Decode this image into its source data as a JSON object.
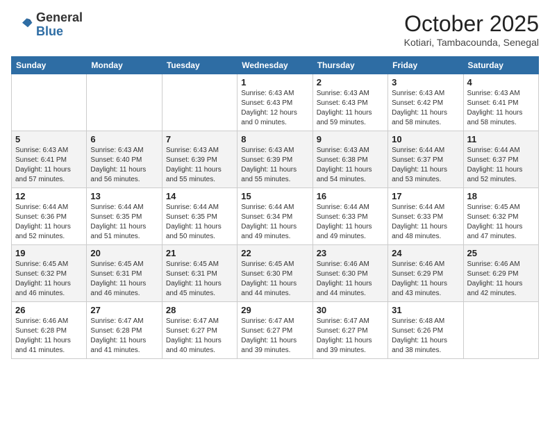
{
  "header": {
    "logo_line1": "General",
    "logo_line2": "Blue",
    "month_title": "October 2025",
    "subtitle": "Kotiari, Tambacounda, Senegal"
  },
  "weekdays": [
    "Sunday",
    "Monday",
    "Tuesday",
    "Wednesday",
    "Thursday",
    "Friday",
    "Saturday"
  ],
  "weeks": [
    [
      {
        "day": "",
        "info": ""
      },
      {
        "day": "",
        "info": ""
      },
      {
        "day": "",
        "info": ""
      },
      {
        "day": "1",
        "info": "Sunrise: 6:43 AM\nSunset: 6:43 PM\nDaylight: 12 hours\nand 0 minutes."
      },
      {
        "day": "2",
        "info": "Sunrise: 6:43 AM\nSunset: 6:43 PM\nDaylight: 11 hours\nand 59 minutes."
      },
      {
        "day": "3",
        "info": "Sunrise: 6:43 AM\nSunset: 6:42 PM\nDaylight: 11 hours\nand 58 minutes."
      },
      {
        "day": "4",
        "info": "Sunrise: 6:43 AM\nSunset: 6:41 PM\nDaylight: 11 hours\nand 58 minutes."
      }
    ],
    [
      {
        "day": "5",
        "info": "Sunrise: 6:43 AM\nSunset: 6:41 PM\nDaylight: 11 hours\nand 57 minutes."
      },
      {
        "day": "6",
        "info": "Sunrise: 6:43 AM\nSunset: 6:40 PM\nDaylight: 11 hours\nand 56 minutes."
      },
      {
        "day": "7",
        "info": "Sunrise: 6:43 AM\nSunset: 6:39 PM\nDaylight: 11 hours\nand 55 minutes."
      },
      {
        "day": "8",
        "info": "Sunrise: 6:43 AM\nSunset: 6:39 PM\nDaylight: 11 hours\nand 55 minutes."
      },
      {
        "day": "9",
        "info": "Sunrise: 6:43 AM\nSunset: 6:38 PM\nDaylight: 11 hours\nand 54 minutes."
      },
      {
        "day": "10",
        "info": "Sunrise: 6:44 AM\nSunset: 6:37 PM\nDaylight: 11 hours\nand 53 minutes."
      },
      {
        "day": "11",
        "info": "Sunrise: 6:44 AM\nSunset: 6:37 PM\nDaylight: 11 hours\nand 52 minutes."
      }
    ],
    [
      {
        "day": "12",
        "info": "Sunrise: 6:44 AM\nSunset: 6:36 PM\nDaylight: 11 hours\nand 52 minutes."
      },
      {
        "day": "13",
        "info": "Sunrise: 6:44 AM\nSunset: 6:35 PM\nDaylight: 11 hours\nand 51 minutes."
      },
      {
        "day": "14",
        "info": "Sunrise: 6:44 AM\nSunset: 6:35 PM\nDaylight: 11 hours\nand 50 minutes."
      },
      {
        "day": "15",
        "info": "Sunrise: 6:44 AM\nSunset: 6:34 PM\nDaylight: 11 hours\nand 49 minutes."
      },
      {
        "day": "16",
        "info": "Sunrise: 6:44 AM\nSunset: 6:33 PM\nDaylight: 11 hours\nand 49 minutes."
      },
      {
        "day": "17",
        "info": "Sunrise: 6:44 AM\nSunset: 6:33 PM\nDaylight: 11 hours\nand 48 minutes."
      },
      {
        "day": "18",
        "info": "Sunrise: 6:45 AM\nSunset: 6:32 PM\nDaylight: 11 hours\nand 47 minutes."
      }
    ],
    [
      {
        "day": "19",
        "info": "Sunrise: 6:45 AM\nSunset: 6:32 PM\nDaylight: 11 hours\nand 46 minutes."
      },
      {
        "day": "20",
        "info": "Sunrise: 6:45 AM\nSunset: 6:31 PM\nDaylight: 11 hours\nand 46 minutes."
      },
      {
        "day": "21",
        "info": "Sunrise: 6:45 AM\nSunset: 6:31 PM\nDaylight: 11 hours\nand 45 minutes."
      },
      {
        "day": "22",
        "info": "Sunrise: 6:45 AM\nSunset: 6:30 PM\nDaylight: 11 hours\nand 44 minutes."
      },
      {
        "day": "23",
        "info": "Sunrise: 6:46 AM\nSunset: 6:30 PM\nDaylight: 11 hours\nand 44 minutes."
      },
      {
        "day": "24",
        "info": "Sunrise: 6:46 AM\nSunset: 6:29 PM\nDaylight: 11 hours\nand 43 minutes."
      },
      {
        "day": "25",
        "info": "Sunrise: 6:46 AM\nSunset: 6:29 PM\nDaylight: 11 hours\nand 42 minutes."
      }
    ],
    [
      {
        "day": "26",
        "info": "Sunrise: 6:46 AM\nSunset: 6:28 PM\nDaylight: 11 hours\nand 41 minutes."
      },
      {
        "day": "27",
        "info": "Sunrise: 6:47 AM\nSunset: 6:28 PM\nDaylight: 11 hours\nand 41 minutes."
      },
      {
        "day": "28",
        "info": "Sunrise: 6:47 AM\nSunset: 6:27 PM\nDaylight: 11 hours\nand 40 minutes."
      },
      {
        "day": "29",
        "info": "Sunrise: 6:47 AM\nSunset: 6:27 PM\nDaylight: 11 hours\nand 39 minutes."
      },
      {
        "day": "30",
        "info": "Sunrise: 6:47 AM\nSunset: 6:27 PM\nDaylight: 11 hours\nand 39 minutes."
      },
      {
        "day": "31",
        "info": "Sunrise: 6:48 AM\nSunset: 6:26 PM\nDaylight: 11 hours\nand 38 minutes."
      },
      {
        "day": "",
        "info": ""
      }
    ]
  ]
}
